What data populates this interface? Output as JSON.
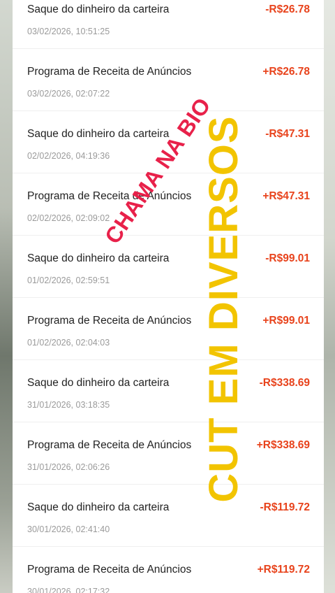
{
  "colors": {
    "amount": "#e8431c",
    "overlay_bio": "#e8214a",
    "overlay_cut": "#f2c400"
  },
  "transactions": [
    {
      "title": "Saque do dinheiro da carteira",
      "date": "03/02/2026, 10:51:25",
      "amount": "-R$26.78"
    },
    {
      "title": "Programa de Receita de Anúncios",
      "date": "03/02/2026, 02:07:22",
      "amount": "+R$26.78"
    },
    {
      "title": "Saque do dinheiro da carteira",
      "date": "02/02/2026, 04:19:36",
      "amount": "-R$47.31"
    },
    {
      "title": "Programa de Receita de Anúncios",
      "date": "02/02/2026, 02:09:02",
      "amount": "+R$47.31"
    },
    {
      "title": "Saque do dinheiro da carteira",
      "date": "01/02/2026, 02:59:51",
      "amount": "-R$99.01"
    },
    {
      "title": "Programa de Receita de Anúncios",
      "date": "01/02/2026, 02:04:03",
      "amount": "+R$99.01"
    },
    {
      "title": "Saque do dinheiro da carteira",
      "date": "31/01/2026, 03:18:35",
      "amount": "-R$338.69"
    },
    {
      "title": "Programa de Receita de Anúncios",
      "date": "31/01/2026, 02:06:26",
      "amount": "+R$338.69"
    },
    {
      "title": "Saque do dinheiro da carteira",
      "date": "30/01/2026, 02:41:40",
      "amount": "-R$119.72"
    },
    {
      "title": "Programa de Receita de Anúncios",
      "date": "30/01/2026, 02:17:32",
      "amount": "+R$119.72"
    }
  ],
  "overlays": {
    "bio": "CHAMA NA BIO",
    "cut": "CUT EM DIVERSOS"
  }
}
